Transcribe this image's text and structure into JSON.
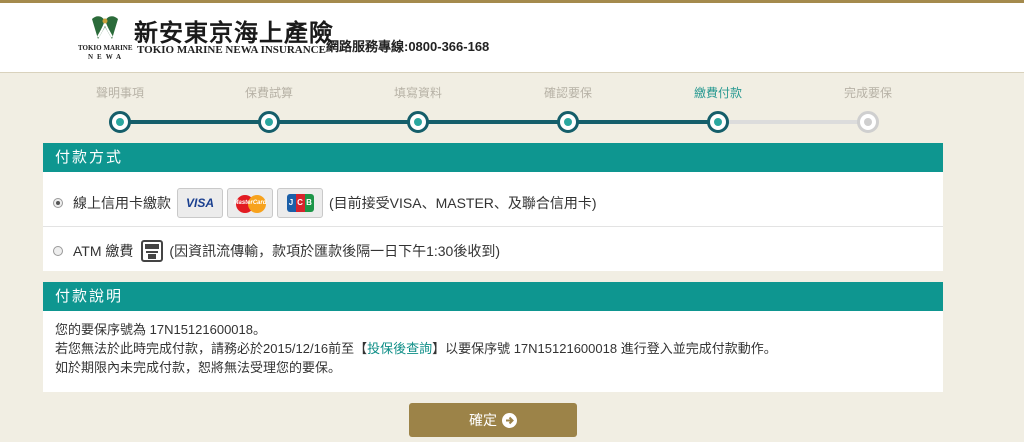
{
  "header": {
    "brand_cn": "新安東京海上產險",
    "brand_en": "TOKIO MARINE NEWA INSURANCE",
    "brand_small": "TOKIO MARINE",
    "brand_newa": "NEWA",
    "hotline_label": "網路服務專線:0800-366-168"
  },
  "steps": [
    {
      "label": "聲明事項",
      "state": "done"
    },
    {
      "label": "保費試算",
      "state": "done"
    },
    {
      "label": "填寫資料",
      "state": "done"
    },
    {
      "label": "確認要保",
      "state": "done"
    },
    {
      "label": "繳費付款",
      "state": "active"
    },
    {
      "label": "完成要保",
      "state": "pending"
    }
  ],
  "payment": {
    "title": "付款方式",
    "options": [
      {
        "label": "線上信用卡繳款",
        "selected": true,
        "note": "(目前接受VISA、MASTER、及聯合信用卡)"
      },
      {
        "label": "ATM 繳費",
        "selected": false,
        "note": "(因資訊流傳輸，款項於匯款後隔一日下午1:30後收到)"
      }
    ],
    "cards": {
      "visa": "VISA",
      "master": "MasterCard",
      "jcb": [
        "J",
        "C",
        "B"
      ]
    },
    "icons": [
      "visa-card-icon",
      "mastercard-icon",
      "jcb-card-icon",
      "atm-icon"
    ]
  },
  "info": {
    "title": "付款說明",
    "line1": "您的要保序號為 17N15121600018。",
    "line2_pre": "若您無法於此時完成付款，請務必於2015/12/16前至【",
    "line2_link": "投保後查詢",
    "line2_post": "】以要保序號 17N15121600018 進行登入並完成付款動作。",
    "line3": "如於期限內未完成付款，恕將無法受理您的要保。"
  },
  "confirm_button": "確定",
  "colors": {
    "teal": "#0e9690",
    "gold": "#9c8348",
    "dark_teal": "#155e6a",
    "background": "#f1eee3"
  }
}
